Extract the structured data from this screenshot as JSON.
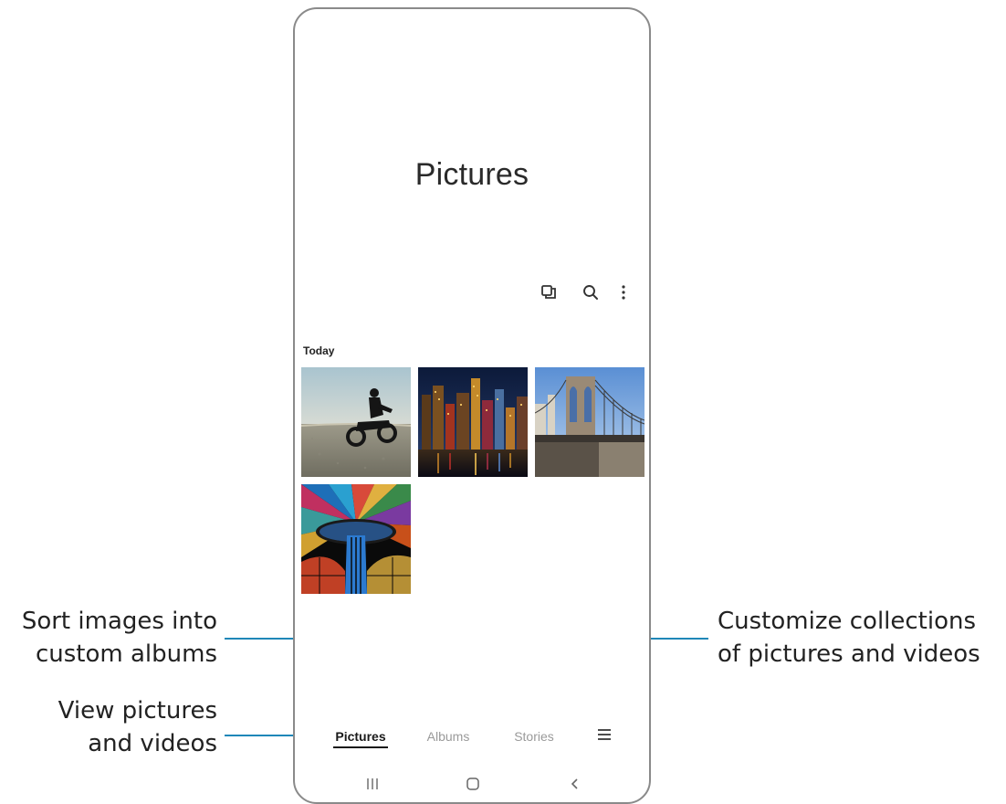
{
  "app": {
    "title": "Pictures"
  },
  "toolbar": {
    "icons": [
      "select-mode-icon",
      "search-icon",
      "more-options-icon"
    ]
  },
  "section": {
    "label": "Today"
  },
  "photos": [
    {
      "subject": "motorcyclist on desert"
    },
    {
      "subject": "city skyline at night"
    },
    {
      "subject": "suspension bridge"
    },
    {
      "subject": "stained glass dome"
    }
  ],
  "tabs": [
    {
      "label": "Pictures",
      "active": true
    },
    {
      "label": "Albums",
      "active": false
    },
    {
      "label": "Stories",
      "active": false
    }
  ],
  "menu_icon": "hamburger-menu-icon",
  "system_nav": [
    "recent-apps-icon",
    "home-icon",
    "back-icon"
  ],
  "callouts": {
    "albums_line1": "Sort images into",
    "albums_line2": "custom albums",
    "pictures_line1": "View pictures",
    "pictures_line2": "and videos",
    "stories_line1": "Customize collections",
    "stories_line2": "of pictures and videos"
  },
  "colors": {
    "leader": "#1f87b8"
  }
}
